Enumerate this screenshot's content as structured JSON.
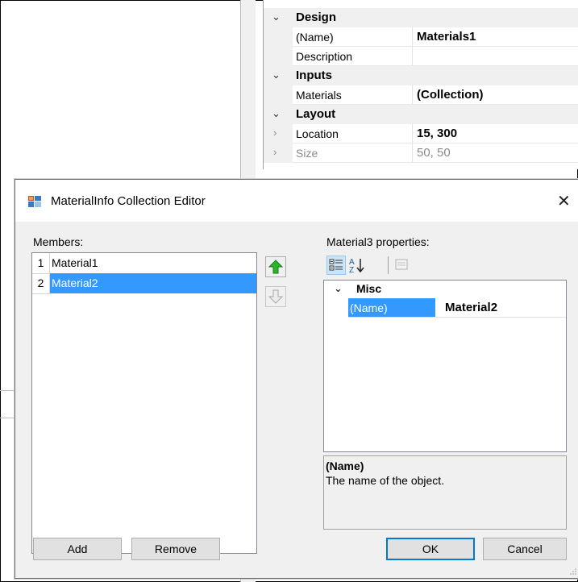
{
  "property_grid": {
    "categories": [
      {
        "label": "Design"
      },
      {
        "label": "Inputs"
      },
      {
        "label": "Layout"
      }
    ],
    "rows": {
      "name": {
        "name": "(Name)",
        "value": "Materials1"
      },
      "description": {
        "name": "Description",
        "value": ""
      },
      "materials": {
        "name": "Materials",
        "value": "(Collection)"
      },
      "location": {
        "name": "Location",
        "value": "15, 300"
      },
      "size": {
        "name": "Size",
        "value": "50, 50"
      }
    }
  },
  "dialog": {
    "title": "MaterialInfo Collection Editor",
    "close_glyph": "✕",
    "members_label": "Members:",
    "members": [
      {
        "index": "1",
        "name": "Material1",
        "selected": false
      },
      {
        "index": "2",
        "name": "Material2",
        "selected": true
      }
    ],
    "properties_label": "Material3 properties:",
    "toolbar": {
      "categorized_icon": "categorized-icon",
      "alphabetical_icon": "sort-alphabetical-icon",
      "property_pages_icon": "property-pages-icon"
    },
    "grid": {
      "category": "Misc",
      "property_name": "(Name)",
      "property_value": "Material2"
    },
    "description": {
      "title": "(Name)",
      "text": "The name of the object."
    },
    "buttons": {
      "add": "Add",
      "remove": "Remove",
      "ok": "OK",
      "cancel": "Cancel"
    },
    "colors": {
      "selection": "#3399ff",
      "accent": "#0078d7",
      "up_arrow": "#22a522"
    }
  }
}
